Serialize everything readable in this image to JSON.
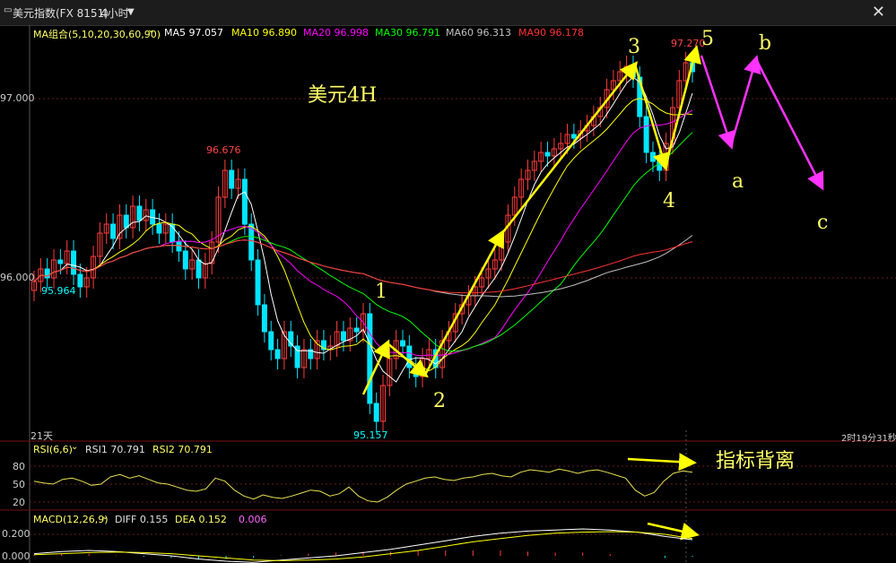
{
  "window": {
    "icon": "window-menu-icon",
    "title": "美元指数(FX 8151)",
    "period": "4小时",
    "period_dropdown_icon": "chevron-down-icon",
    "close_icon": "close-icon"
  },
  "ma_legend": {
    "group": "MA组合(5,10,20,30,60,90)",
    "items": [
      {
        "label": "MA5 97.057",
        "color": "#ffffff"
      },
      {
        "label": "MA10 96.890",
        "color": "#ffff00"
      },
      {
        "label": "MA20 96.998",
        "color": "#ff00ff"
      },
      {
        "label": "MA30 96.791",
        "color": "#00ff00"
      },
      {
        "label": "MA60 96.313",
        "color": "#c0c0c0"
      },
      {
        "label": "MA90 96.178",
        "color": "#ff3333"
      }
    ]
  },
  "rsi_legend": {
    "group": "RSI(6,6)",
    "rsi1": "RSI1 70.791",
    "rsi2": "RSI2 70.791"
  },
  "macd_legend": {
    "group": "MACD(12,26,9)",
    "diff": "DIFF 0.155",
    "dea": "DEA 0.152",
    "macd": "0.006"
  },
  "status": {
    "days": "21天",
    "countdown": "2时19分31秒"
  },
  "chart_data": [
    {
      "type": "candlestick",
      "title": "美元4H",
      "y_ticks": [
        "97.000",
        "96.000"
      ],
      "price_labels": {
        "high_left": "96.676",
        "low_left": "95.964",
        "low": "95.157",
        "high_right": "97.270"
      },
      "close": [
        95.98,
        96.05,
        96.0,
        96.1,
        96.08,
        96.15,
        96.02,
        95.95,
        96.0,
        96.12,
        96.25,
        96.3,
        96.22,
        96.35,
        96.28,
        96.4,
        96.32,
        96.38,
        96.3,
        96.25,
        96.3,
        96.2,
        96.15,
        96.05,
        96.1,
        96.0,
        96.08,
        96.2,
        96.45,
        96.6,
        96.5,
        96.55,
        96.3,
        96.1,
        95.85,
        95.7,
        95.6,
        95.55,
        95.7,
        95.62,
        95.5,
        95.6,
        95.55,
        95.65,
        95.6,
        95.62,
        95.7,
        95.65,
        95.72,
        95.7,
        95.8,
        95.3,
        95.2,
        95.4,
        95.55,
        95.65,
        95.62,
        95.5,
        95.45,
        95.55,
        95.6,
        95.5,
        95.65,
        95.7,
        95.8,
        95.85,
        95.9,
        95.95,
        96.0,
        96.05,
        96.1,
        96.2,
        96.35,
        96.45,
        96.55,
        96.6,
        96.65,
        96.7,
        96.68,
        96.72,
        96.75,
        96.8,
        96.78,
        96.82,
        96.85,
        96.9,
        96.95,
        97.05,
        97.1,
        97.15,
        97.18,
        97.12,
        96.9,
        96.7,
        96.65,
        96.6,
        96.75,
        96.95,
        97.1,
        97.2,
        97.15
      ],
      "ma_lines": [
        "MA5",
        "MA10",
        "MA20",
        "MA30",
        "MA60",
        "MA90"
      ],
      "wave_labels": [
        {
          "text": "1",
          "color": "#ffff66"
        },
        {
          "text": "2",
          "color": "#ffff66"
        },
        {
          "text": "3",
          "color": "#ffff66"
        },
        {
          "text": "4",
          "color": "#ffff66"
        },
        {
          "text": "5",
          "color": "#ffff66"
        },
        {
          "text": "a",
          "color": "#ffff66"
        },
        {
          "text": "b",
          "color": "#ffff66"
        },
        {
          "text": "c",
          "color": "#ffff66"
        }
      ]
    },
    {
      "type": "line",
      "name": "RSI",
      "y_ticks": [
        "80",
        "50",
        "20"
      ],
      "annotation": "指标背离",
      "values": [
        55,
        52,
        50,
        58,
        60,
        55,
        48,
        50,
        62,
        66,
        60,
        64,
        58,
        52,
        50,
        45,
        40,
        38,
        42,
        60,
        55,
        40,
        30,
        25,
        32,
        28,
        26,
        30,
        35,
        40,
        38,
        30,
        34,
        45,
        30,
        22,
        20,
        28,
        40,
        50,
        55,
        60,
        62,
        58,
        56,
        60,
        62,
        66,
        68,
        64,
        62,
        70,
        74,
        72,
        70,
        75,
        72,
        68,
        72,
        74,
        70,
        65,
        60,
        40,
        30,
        36,
        55,
        68,
        72,
        70
      ]
    },
    {
      "type": "line",
      "name": "MACD",
      "y_ticks": [
        "0.200",
        "0.000"
      ],
      "diff": [
        0.02,
        0.04,
        0.05,
        0.04,
        0.02,
        0.0,
        -0.03,
        -0.05,
        -0.06,
        -0.04,
        -0.02,
        0.0,
        0.03,
        0.06,
        0.1,
        0.14,
        0.18,
        0.21,
        0.23,
        0.24,
        0.25,
        0.24,
        0.22,
        0.18,
        0.15
      ],
      "dea": [
        0.01,
        0.02,
        0.03,
        0.035,
        0.03,
        0.02,
        0.0,
        -0.02,
        -0.04,
        -0.045,
        -0.04,
        -0.03,
        -0.01,
        0.02,
        0.05,
        0.09,
        0.13,
        0.16,
        0.19,
        0.21,
        0.22,
        0.225,
        0.22,
        0.2,
        0.16
      ]
    }
  ]
}
